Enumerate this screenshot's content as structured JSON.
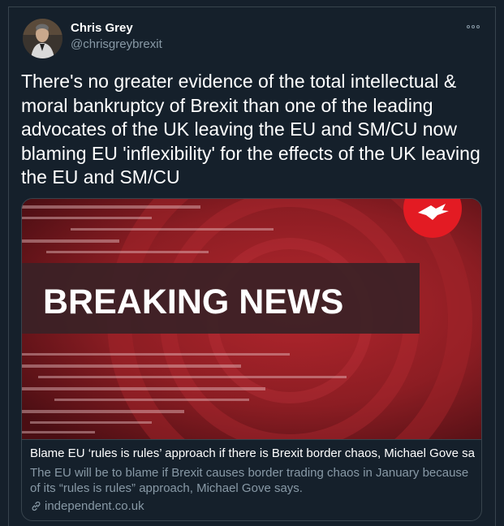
{
  "author": {
    "display_name": "Chris Grey",
    "handle": "@chrisgreybrexit"
  },
  "tweet": {
    "text": "There's no greater evidence of the total intellectual & moral bankruptcy of Brexit than one of the leading advocates of the UK leaving the EU and SM/CU now blaming EU 'inflexibility' for the effects of the UK leaving the EU and SM/CU"
  },
  "card": {
    "image_headline": "BREAKING NEWS",
    "title": "Blame EU ‘rules is rules’ approach if there is Brexit border chaos, Michael Gove sa...",
    "description": "The EU will be to blame if Brexit causes border trading chaos in January because of its “rules is rules” approach, Michael Gove says.",
    "domain": "independent.co.uk"
  },
  "icons": {
    "more": "more-horizontal-icon",
    "link": "link-icon",
    "logo": "independent-eagle-logo"
  },
  "colors": {
    "background": "#15202b",
    "border": "#38444d",
    "secondary_text": "#8899a6",
    "banner_red": "#8c1d23",
    "logo_red": "#e31b23"
  }
}
